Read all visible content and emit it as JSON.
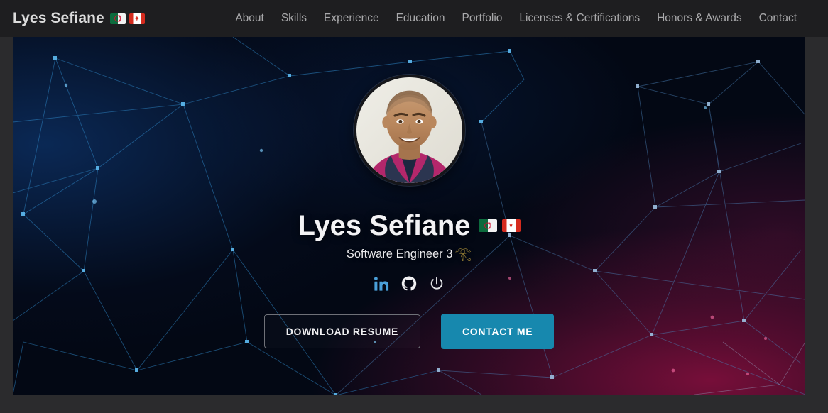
{
  "theme": {
    "page_bg": "#2b2b2d",
    "navbar_bg": "#1e1e20",
    "nav_link_color": "#a9a9ab",
    "accent_teal": "#1788ae",
    "linkedin_blue": "#4a9fd8",
    "horus_gold": "#d8b444",
    "hero_navy": "#03101f",
    "hero_crimson": "#be1250"
  },
  "navbar": {
    "brand": "Lyes Sefiane",
    "brand_flags": [
      "algeria-flag",
      "canada-flag"
    ],
    "links": [
      {
        "label": "About"
      },
      {
        "label": "Skills"
      },
      {
        "label": "Experience"
      },
      {
        "label": "Education"
      },
      {
        "label": "Portfolio"
      },
      {
        "label": "Licenses & Certifications"
      },
      {
        "label": "Honors & Awards"
      },
      {
        "label": "Contact"
      }
    ]
  },
  "hero": {
    "avatar_alt": "profile-photo",
    "name": "Lyes Sefiane",
    "name_flags": [
      "algeria-flag",
      "canada-flag"
    ],
    "tagline": "Software Engineer 3",
    "tagline_glyph": "𓂀",
    "socials": [
      {
        "name": "linkedin-icon",
        "label": "LinkedIn"
      },
      {
        "name": "github-icon",
        "label": "GitHub"
      },
      {
        "name": "power-icon",
        "label": "Power"
      }
    ],
    "buttons": {
      "download_label": "DOWNLOAD RESUME",
      "contact_label": "CONTACT ME"
    }
  }
}
